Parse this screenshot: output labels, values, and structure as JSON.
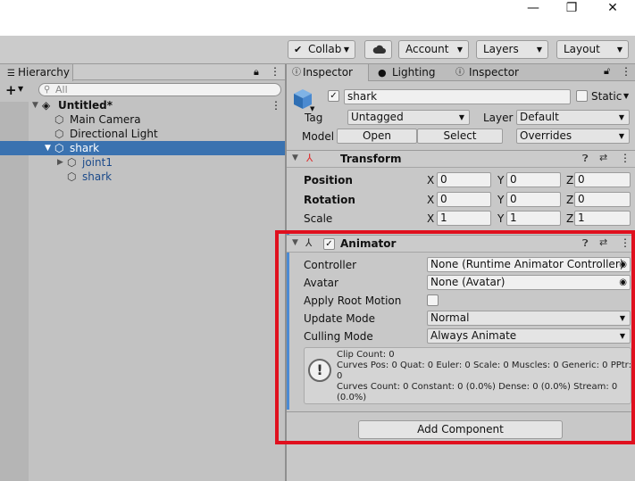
{
  "window_controls": {
    "minimize": "—",
    "restore": "❐",
    "close": "✕"
  },
  "toolbar": {
    "collab": "Collab",
    "account": "Account",
    "layers": "Layers",
    "layout": "Layout"
  },
  "hierarchy": {
    "tab_label": "Hierarchy",
    "add_label": "+",
    "search_placeholder": "All",
    "scene_name": "Untitled*",
    "items": [
      {
        "label": "Main Camera"
      },
      {
        "label": "Directional Light"
      },
      {
        "label": "shark"
      },
      {
        "label": "joint1"
      },
      {
        "label": "shark"
      }
    ]
  },
  "inspector": {
    "tabs": [
      "Inspector",
      "Lighting",
      "Inspector"
    ],
    "object_name": "shark",
    "static_label": "Static",
    "tag_label": "Tag",
    "tag_value": "Untagged",
    "layer_label": "Layer",
    "layer_value": "Default",
    "model_label": "Model",
    "open_label": "Open",
    "select_label": "Select",
    "overrides_label": "Overrides",
    "transform": {
      "title": "Transform",
      "position_label": "Position",
      "rotation_label": "Rotation",
      "scale_label": "Scale",
      "position": {
        "x": "0",
        "y": "0",
        "z": "0"
      },
      "rotation": {
        "x": "0",
        "y": "0",
        "z": "0"
      },
      "scale": {
        "x": "1",
        "y": "1",
        "z": "1"
      },
      "axis": {
        "x": "X",
        "y": "Y",
        "z": "Z"
      }
    },
    "animator": {
      "title": "Animator",
      "controller_label": "Controller",
      "controller_value": "None (Runtime Animator Controller)",
      "avatar_label": "Avatar",
      "avatar_value": "None (Avatar)",
      "apply_root_motion_label": "Apply Root Motion",
      "update_mode_label": "Update Mode",
      "update_mode_value": "Normal",
      "culling_mode_label": "Culling Mode",
      "culling_mode_value": "Always Animate",
      "info_lines": [
        "Clip Count: 0",
        "Curves Pos: 0 Quat: 0 Euler: 0 Scale: 0 Muscles: 0 Generic: 0 PPtr: 0",
        "Curves Count: 0 Constant: 0 (0.0%) Dense: 0 (0.0%) Stream: 0",
        "(0.0%)"
      ]
    },
    "add_component_label": "Add Component"
  },
  "colors": {
    "selection": "#3a72b0",
    "highlight_box": "#e0101e"
  }
}
